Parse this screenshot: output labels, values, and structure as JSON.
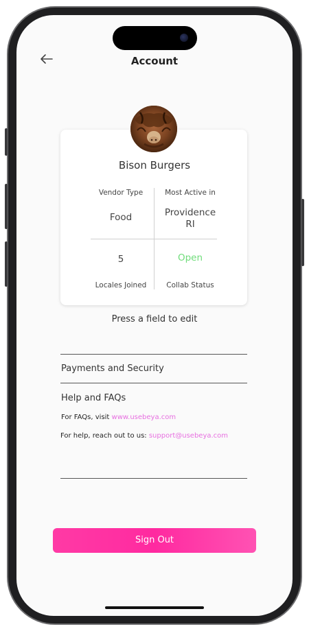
{
  "header": {
    "title": "Account"
  },
  "profile": {
    "vendor_name": "Bison Burgers",
    "avatar_icon": "bison-avatar"
  },
  "stats": {
    "vendor_type_label": "Vendor Type",
    "vendor_type_value": "Food",
    "most_active_label": "Most Active in",
    "most_active_value_line1": "Providence",
    "most_active_value_line2": "RI",
    "locales_value": "5",
    "locales_label": "Locales Joined",
    "collab_value": "Open",
    "collab_label": "Collab Status"
  },
  "hint": "Press a field to edit",
  "sections": {
    "payments": "Payments and Security",
    "help": "Help and FAQs",
    "faq_prefix": "For FAQs, visit ",
    "faq_link": "www.usebeya.com",
    "help_prefix": "For help, reach out to us: ",
    "help_link": "support@usebeya.com"
  },
  "actions": {
    "sign_out": "Sign Out"
  },
  "colors": {
    "accent_pink": "#ff2aa0",
    "link_pink": "#e76fe0",
    "status_green": "#6fdc7a"
  }
}
